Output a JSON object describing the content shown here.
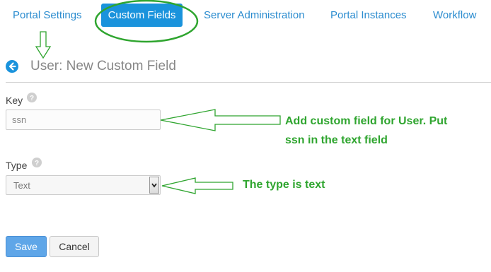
{
  "nav": {
    "items": [
      "Portal Settings",
      "Custom Fields",
      "Server Administration",
      "Portal Instances",
      "Workflow"
    ],
    "active_index": 1
  },
  "header": {
    "back_icon": "back-arrow-circle-icon",
    "title": "User: New Custom Field"
  },
  "form": {
    "key_label": "Key",
    "key_value": "ssn",
    "type_label": "Type",
    "type_value": "Text",
    "help_icon": "question-circle-icon"
  },
  "annotations": {
    "key_note_line1": "Add custom field for User. Put",
    "key_note_line2": "ssn in the text field",
    "type_note": "The type is text",
    "color": "#2fa52f"
  },
  "buttons": {
    "save": "Save",
    "cancel": "Cancel"
  },
  "colors": {
    "accent": "#1a93dc",
    "annotation": "#2fa52f"
  }
}
